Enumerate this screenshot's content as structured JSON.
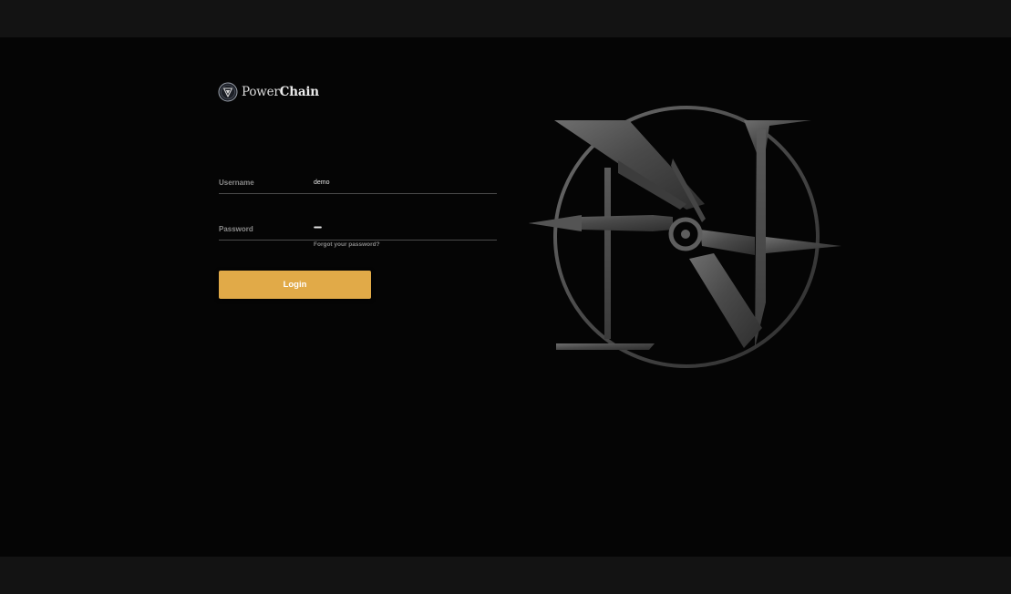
{
  "brand": {
    "name_regular": "Power",
    "name_bold": "Chain",
    "logo_icon": "powerchain-shield-icon"
  },
  "login_form": {
    "username_label": "Username",
    "username_value": "demo",
    "password_label": "Password",
    "password_value": "••••••••",
    "forgot_password_link": "Forgot your password?",
    "login_button": "Login"
  },
  "emblem": {
    "icon": "compass-n-emblem-icon"
  },
  "colors": {
    "accent": "#e1aa48",
    "background": "#050505",
    "chrome_bar": "#131313",
    "label": "#8a8a8a"
  }
}
